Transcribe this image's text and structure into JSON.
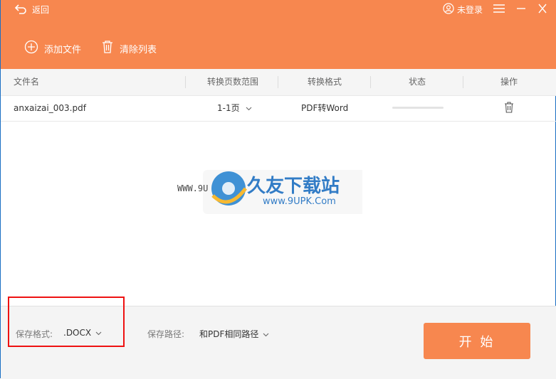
{
  "header": {
    "back_label": "返回",
    "login_label": "未登录",
    "toolbar": {
      "add_label": "添加文件",
      "clear_label": "清除列表"
    }
  },
  "table": {
    "columns": [
      "文件名",
      "转换页数范围",
      "转换格式",
      "状态",
      "操作"
    ],
    "rows": [
      {
        "filename": "anxaizai_003.pdf",
        "range": "1-1页",
        "format": "PDF转Word",
        "progress": 0
      }
    ]
  },
  "watermark": {
    "title": "久友下载站",
    "left_text": "WWW.9U",
    "url": "www.9UPK.Com"
  },
  "footer": {
    "format_label": "保存格式:",
    "format_value": ".DOCX",
    "path_label": "保存路径:",
    "path_value": "和PDF相同路径",
    "start_label": "开 始"
  },
  "colors": {
    "accent": "#f7874f",
    "highlight": "#ee1111"
  }
}
